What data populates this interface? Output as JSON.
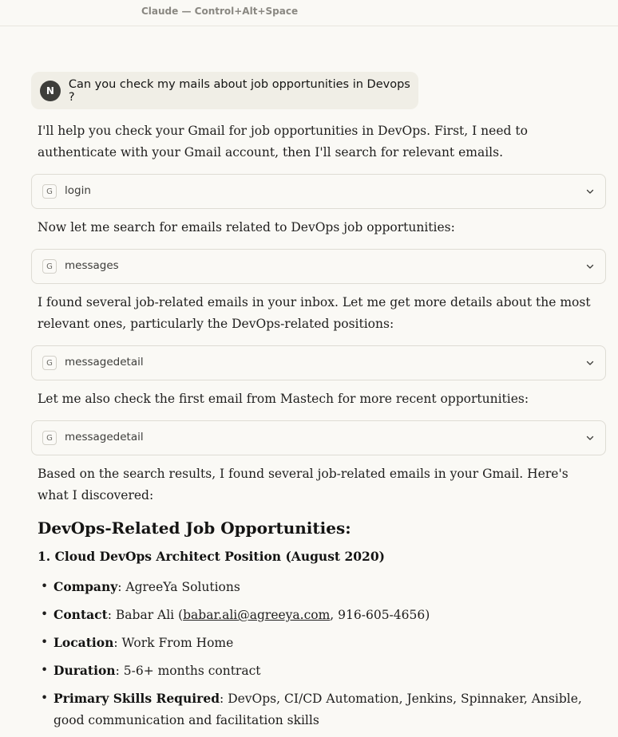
{
  "window": {
    "title": "Claude — Control+Alt+Space"
  },
  "user_message": {
    "avatar_initial": "N",
    "text": "Can you check my mails about job opportunities in Devops ?"
  },
  "assistant": {
    "para1": "I'll help you check your Gmail for job opportunities in DevOps. First, I need to authenticate with your Gmail account, then I'll search for relevant emails.",
    "tool1": {
      "icon": "G",
      "name": "login"
    },
    "para2": "Now let me search for emails related to DevOps job opportunities:",
    "tool2": {
      "icon": "G",
      "name": "messages"
    },
    "para3": "I found several job-related emails in your inbox. Let me get more details about the most relevant ones, particularly the DevOps-related positions:",
    "tool3": {
      "icon": "G",
      "name": "messagedetail"
    },
    "para4": "Let me also check the first email from Mastech for more recent opportunities:",
    "tool4": {
      "icon": "G",
      "name": "messagedetail"
    },
    "para5": "Based on the search results, I found several job-related emails in your Gmail. Here's what I discovered:",
    "heading": "DevOps-Related Job Opportunities:",
    "subheading": "1. Cloud DevOps Architect Position (August 2020)",
    "details": {
      "company_label": "Company",
      "company_value": ": AgreeYa Solutions",
      "contact_label": "Contact",
      "contact_prefix": ": Babar Ali (",
      "contact_email": "babar.ali@agreeya.com",
      "contact_suffix": ", 916-605-4656)",
      "location_label": "Location",
      "location_value": ": Work From Home",
      "duration_label": "Duration",
      "duration_value": ": 5-6+ months contract",
      "skills_label": "Primary Skills Required",
      "skills_value": ": DevOps, CI/CD Automation, Jenkins, Spinnaker, Ansible, good communication and facilitation skills"
    }
  }
}
